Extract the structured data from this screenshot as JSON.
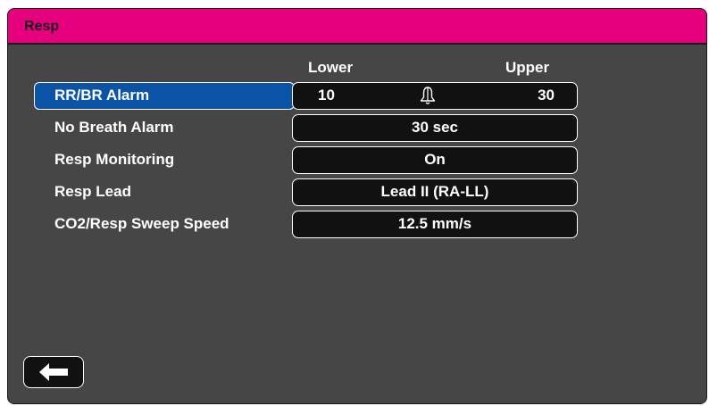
{
  "window": {
    "title": "Resp",
    "title_color": "#e6007e",
    "background_color": "#464646"
  },
  "columns": {
    "lower": "Lower",
    "upper": "Upper"
  },
  "rows": [
    {
      "label": "RR/BR Alarm",
      "lower": "10",
      "upper": "30",
      "icon": "alarm-bell-icon",
      "selected": true
    },
    {
      "label": "No Breath Alarm",
      "value": "30 sec"
    },
    {
      "label": "Resp Monitoring",
      "value": "On"
    },
    {
      "label": "Resp Lead",
      "value": "Lead II (RA-LL)"
    },
    {
      "label": "CO2/Resp Sweep Speed",
      "value": "12.5 mm/s"
    }
  ],
  "footer": {
    "back_icon": "back-arrow-icon"
  },
  "colors": {
    "selection": "#0a53a6",
    "value_box": "#111111",
    "text": "#ffffff"
  }
}
